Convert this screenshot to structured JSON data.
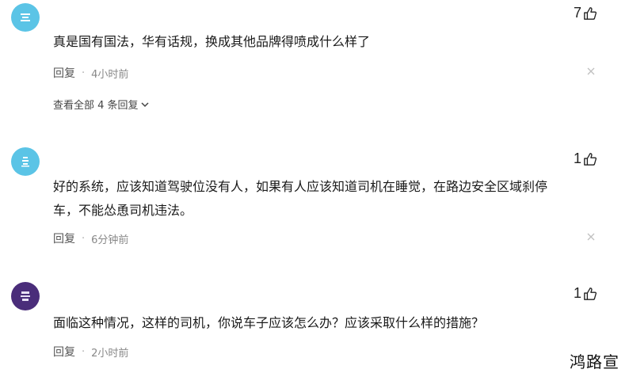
{
  "comments": [
    {
      "likes": "7",
      "text": "真是国有国法，华有话规，换成其他品牌得喷成什么样了",
      "reply_label": "回复",
      "time": "4小时前",
      "view_all": "查看全部 4 条回复",
      "avatar_color": "#5bc4e6"
    },
    {
      "likes": "1",
      "text": "好的系统，应该知道驾驶位没有人，如果有人应该知道司机在睡觉，在路边安全区域刹停车，不能怂恿司机违法。",
      "reply_label": "回复",
      "time": "6分钟前",
      "avatar_color": "#5bc4e6"
    },
    {
      "likes": "1",
      "text": "面临这种情况，这样的司机，你说车子应该怎么办？应该采取什么样的措施？",
      "reply_label": "回复",
      "time": "2小时前",
      "avatar_color": "#4a2d7a"
    }
  ],
  "separator": "·",
  "watermark": "鸿路宣",
  "icons": {
    "like": "thumbs-up-icon",
    "close": "close-icon",
    "chevron": "chevron-down-icon"
  }
}
